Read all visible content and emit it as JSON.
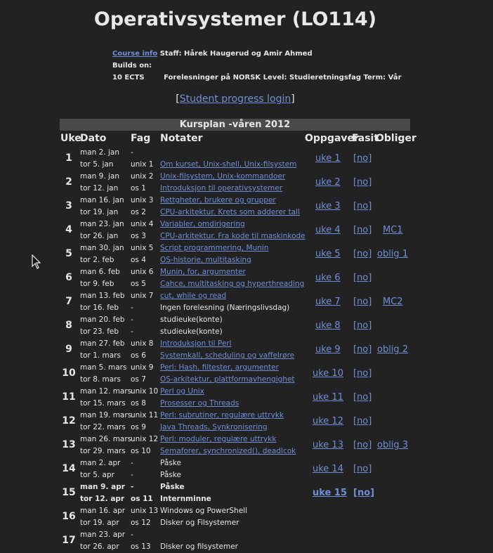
{
  "title": "Operativsystemer (LO114)",
  "info": {
    "course_info": "Course info",
    "staff": "Staff: Hårek Haugerud og Amir Ahmed",
    "builds_on": "Builds on:",
    "ects": "10 ECTS",
    "lectures": "Forelesninger på NORSK",
    "level": "Level: Studieretningsfag",
    "term": "Term: Vår"
  },
  "login": {
    "open": "[",
    "link": "Student progress login",
    "close": "]"
  },
  "kursplan_title": "Kursplan -våren 2012",
  "headers": {
    "uke": "Uke",
    "dato": "Dato",
    "fag": "Fag",
    "notater": "Notater",
    "oppgaver": "Oppgaver",
    "fasit": "Fasit",
    "obliger": "Obliger"
  },
  "weeks": [
    {
      "no": "1",
      "d1": "man  2. jan",
      "f1": "-",
      "n1": "",
      "d2": "tor  5. jan",
      "f2": "unix 1",
      "n2": "Om kurset, Unix-shell, Unix-filsystem",
      "opp": "uke 1",
      "fasit": "[no]",
      "oblig": ""
    },
    {
      "no": "2",
      "d1": "man  9. jan",
      "f1": "unix 2",
      "n1": "Unix-filsystem, Unix-kommandoer",
      "d2": "tor 12. jan",
      "f2": "os 1",
      "n2": "Introduksjon til operativsystemer",
      "opp": "uke 2",
      "fasit": "[no]",
      "oblig": ""
    },
    {
      "no": "3",
      "d1": "man 16. jan",
      "f1": "unix 3",
      "n1": "Rettgheter, brukere og grupper",
      "d2": "tor 19. jan",
      "f2": "os 2",
      "n2": "CPU-arkitektur. Krets som adderer tall",
      "opp": "uke 3",
      "fasit": "[no]",
      "oblig": ""
    },
    {
      "no": "4",
      "d1": "man 23. jan",
      "f1": "unix 4",
      "n1": "Variabler, omdirigering",
      "d2": "tor 26. jan",
      "f2": "os 3",
      "n2": "CPU-arkitektur. Fra kode til maskinkode",
      "opp": "uke 4",
      "fasit": "[no]",
      "oblig": "MC1"
    },
    {
      "no": "5",
      "d1": "man 30. jan",
      "f1": "unix 5",
      "n1": "Script programmering, Munin",
      "d2": "tor  2. feb",
      "f2": "os 4",
      "n2": "OS-historie, multitasking",
      "opp": "uke 5",
      "fasit": "[no]",
      "oblig": "oblig 1"
    },
    {
      "no": "6",
      "d1": "man  6. feb",
      "f1": "unix 6",
      "n1": "Munin, for, argumenter",
      "d2": "tor  9. feb",
      "f2": "os 5",
      "n2": "Cahce, multitasking og hyperthreading",
      "opp": "uke 6",
      "fasit": "[no]",
      "oblig": ""
    },
    {
      "no": "7",
      "d1": "man 13. feb",
      "f1": "unix 7",
      "n1": "cut, while og read",
      "d2": "tor 16. feb",
      "f2": "-",
      "n2": "Ingen forelesning (Næringslivsdag)",
      "n2plain": true,
      "opp": "uke 7",
      "fasit": "[no]",
      "oblig": "MC2"
    },
    {
      "no": "8",
      "d1": "man 20. feb",
      "f1": "-",
      "n1": "studieuke(konte)",
      "n1plain": true,
      "d2": "tor 23. feb",
      "f2": "-",
      "n2": "studieuke(konte)",
      "n2plain": true,
      "opp": "uke 8",
      "fasit": "[no]",
      "oblig": ""
    },
    {
      "no": "9",
      "d1": "man 27. feb",
      "f1": "unix 8",
      "n1": "Introduksjon til Perl",
      "d2": "tor  1. mars",
      "f2": "os 6",
      "n2": "Systemkall, scheduling og vaffelrøre",
      "opp": "uke 9",
      "fasit": "[no]",
      "oblig": "oblig 2"
    },
    {
      "no": "10",
      "d1": "man  5. mars",
      "f1": "unix 9",
      "n1": "Perl: Hash, filtester, argumenter",
      "d2": "tor  8. mars",
      "f2": "os 7",
      "n2": "OS-arkitektur, plattformavhengighet",
      "opp": "uke 10",
      "fasit": "[no]",
      "oblig": ""
    },
    {
      "no": "11",
      "d1": "man 12. mars",
      "f1": "unix 10",
      "n1": "Perl og Unix",
      "d2": "tor 15. mars",
      "f2": "os 8",
      "n2": "Prosesser og Threads",
      "opp": "uke 11",
      "fasit": "[no]",
      "oblig": ""
    },
    {
      "no": "12",
      "d1": "man 19. mars",
      "f1": "unix 11",
      "n1": "Perl: subrutiner, regulære uttrykk",
      "d2": "tor 22. mars",
      "f2": "os 9",
      "n2": "Java Threads, Synkronisering",
      "opp": "uke 12",
      "fasit": "[no]",
      "oblig": ""
    },
    {
      "no": "13",
      "d1": "man 26. mars",
      "f1": "unix 12",
      "n1": "Perl: moduler, regulære uttrykk",
      "d2": "tor 29. mars",
      "f2": "os 10",
      "n2": "Semaforer, synchronized(), deadlcok",
      "opp": "uke 13",
      "fasit": "[no]",
      "oblig": "oblig 3"
    },
    {
      "no": "14",
      "d1": "man  2. apr",
      "f1": "-",
      "n1": "Påske",
      "n1plain": true,
      "d2": "tor  5. apr",
      "f2": "-",
      "n2": "Påske",
      "n2plain": true,
      "opp": "uke 14",
      "fasit": "[no]",
      "oblig": ""
    },
    {
      "no": "15",
      "bold": true,
      "d1": "man 9. apr",
      "f1": "-",
      "n1": "Påske",
      "n1plain": true,
      "d2": "tor 12. apr",
      "f2": "os 11",
      "n2": "Internminne",
      "n2plain": true,
      "opp": "uke 15",
      "fasit": "[no]",
      "oblig": ""
    },
    {
      "no": "16",
      "d1": "man 16. apr",
      "f1": "unix 13",
      "n1": "Windows og PowerShell",
      "n1plain": true,
      "d2": "tor 19. apr",
      "f2": "os 12",
      "n2": "Disker og Filsystemer",
      "n2plain": true,
      "opp": "",
      "fasit": "",
      "oblig": ""
    },
    {
      "no": "17",
      "d1": "man 23. apr",
      "f1": "-",
      "n1": "",
      "d2": "tor 26. apr",
      "f2": "os 13",
      "n2": "Disker og filsystemer",
      "n2plain": true,
      "opp": "",
      "fasit": "",
      "oblig": ""
    }
  ]
}
